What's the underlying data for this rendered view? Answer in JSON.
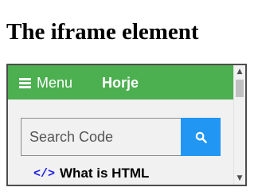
{
  "page": {
    "title": "The iframe element"
  },
  "iframe": {
    "topbar": {
      "menu_label": "Menu",
      "brand": "Horje"
    },
    "search": {
      "placeholder": "Search Code"
    },
    "nav_link": {
      "label": "What is HTML"
    },
    "scrollbar": {
      "up_arrow": "▲",
      "down_arrow": "▼"
    }
  },
  "colors": {
    "topbar_bg": "#4caf50",
    "search_button_bg": "#2196f3",
    "code_icon": "#1a1ae6",
    "frame_border": "#4d4d4d"
  },
  "icons": [
    "hamburger-icon",
    "search-icon",
    "code-icon",
    "scroll-up-arrow-icon",
    "scroll-down-arrow-icon"
  ]
}
